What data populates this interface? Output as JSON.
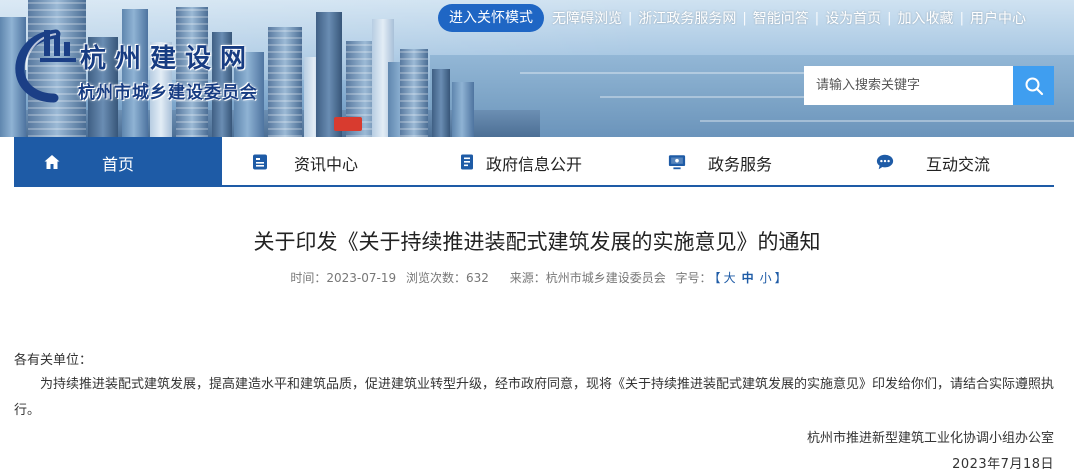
{
  "header": {
    "site_title": "杭州建设网",
    "site_subtitle": "杭州市城乡建设委员会",
    "care_mode_label": "进入关怀模式",
    "top_links": [
      "无障碍浏览",
      "浙江政务服务网",
      "智能问答",
      "设为首页",
      "加入收藏",
      "用户中心"
    ],
    "search_placeholder": "请输入搜索关键字"
  },
  "nav": {
    "items": [
      {
        "label": "首页",
        "icon": "home-icon",
        "active": true
      },
      {
        "label": "资讯中心",
        "icon": "news-icon",
        "active": false
      },
      {
        "label": "政府信息公开",
        "icon": "document-icon",
        "active": false
      },
      {
        "label": "政务服务",
        "icon": "monitor-icon",
        "active": false
      },
      {
        "label": "互动交流",
        "icon": "chat-icon",
        "active": false
      }
    ]
  },
  "article": {
    "title": "关于印发《关于持续推进装配式建筑发展的实施意见》的通知",
    "meta": {
      "time": "时间：2023-07-19",
      "views": "浏览次数：632",
      "source": "来源：杭州市城乡建设委员会",
      "font_size_label": "字号：",
      "font_open": "【",
      "font_large": "大",
      "font_medium": "中",
      "font_small": "小",
      "font_close": "】"
    },
    "salutation": "各有关单位：",
    "body": "为持续推进装配式建筑发展，提高建造水平和建筑品质，促进建筑业转型升级，经市政府同意，现将《关于持续推进装配式建筑发展的实施意见》印发给你们，请结合实际遵照执行。",
    "signature_org": "杭州市推进新型建筑工业化协调小组办公室",
    "signature_date": "2023年7月18日"
  },
  "colors": {
    "primary": "#1e5ba6",
    "care_button": "#1f66c4",
    "search_button": "#3f9ef0",
    "logo_text": "#173c82"
  }
}
